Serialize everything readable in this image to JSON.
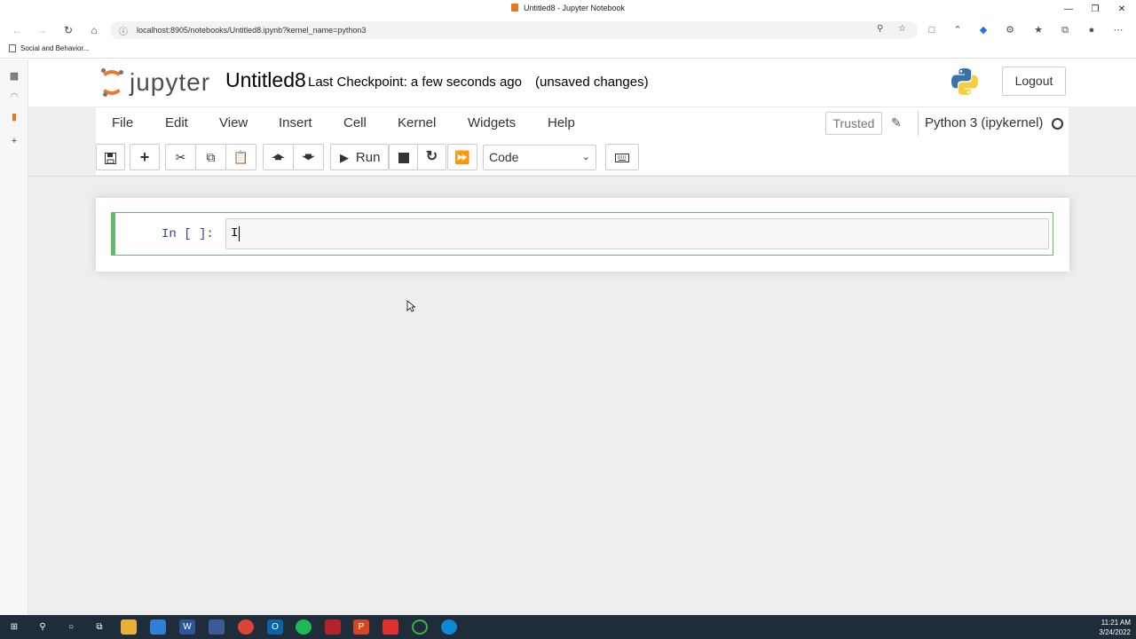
{
  "browser": {
    "window_title": "Untitled8 - Jupyter Notebook",
    "url": "localhost:8905/notebooks/Untitled8.ipynb?kernel_name=python3",
    "bookmark": "Social and Behavior..."
  },
  "header": {
    "logo_text": "jupyter",
    "notebook_name": "Untitled8",
    "checkpoint": "Last Checkpoint: a few seconds ago",
    "autosave_status": "(unsaved changes)",
    "logout_label": "Logout"
  },
  "menubar": {
    "items": [
      "File",
      "Edit",
      "View",
      "Insert",
      "Cell",
      "Kernel",
      "Widgets",
      "Help"
    ],
    "trusted_label": "Trusted",
    "kernel_name": "Python 3 (ipykernel)"
  },
  "toolbar": {
    "run_label": "Run",
    "cell_type": "Code"
  },
  "cell": {
    "prompt": "In [ ]:",
    "code": "I"
  },
  "taskbar": {
    "time": "11:21 AM",
    "date": "3/24/2022"
  },
  "colors": {
    "jupyter_orange": "#f37726",
    "cell_selected": "#66bb6a",
    "prompt_blue": "#303f9f"
  }
}
